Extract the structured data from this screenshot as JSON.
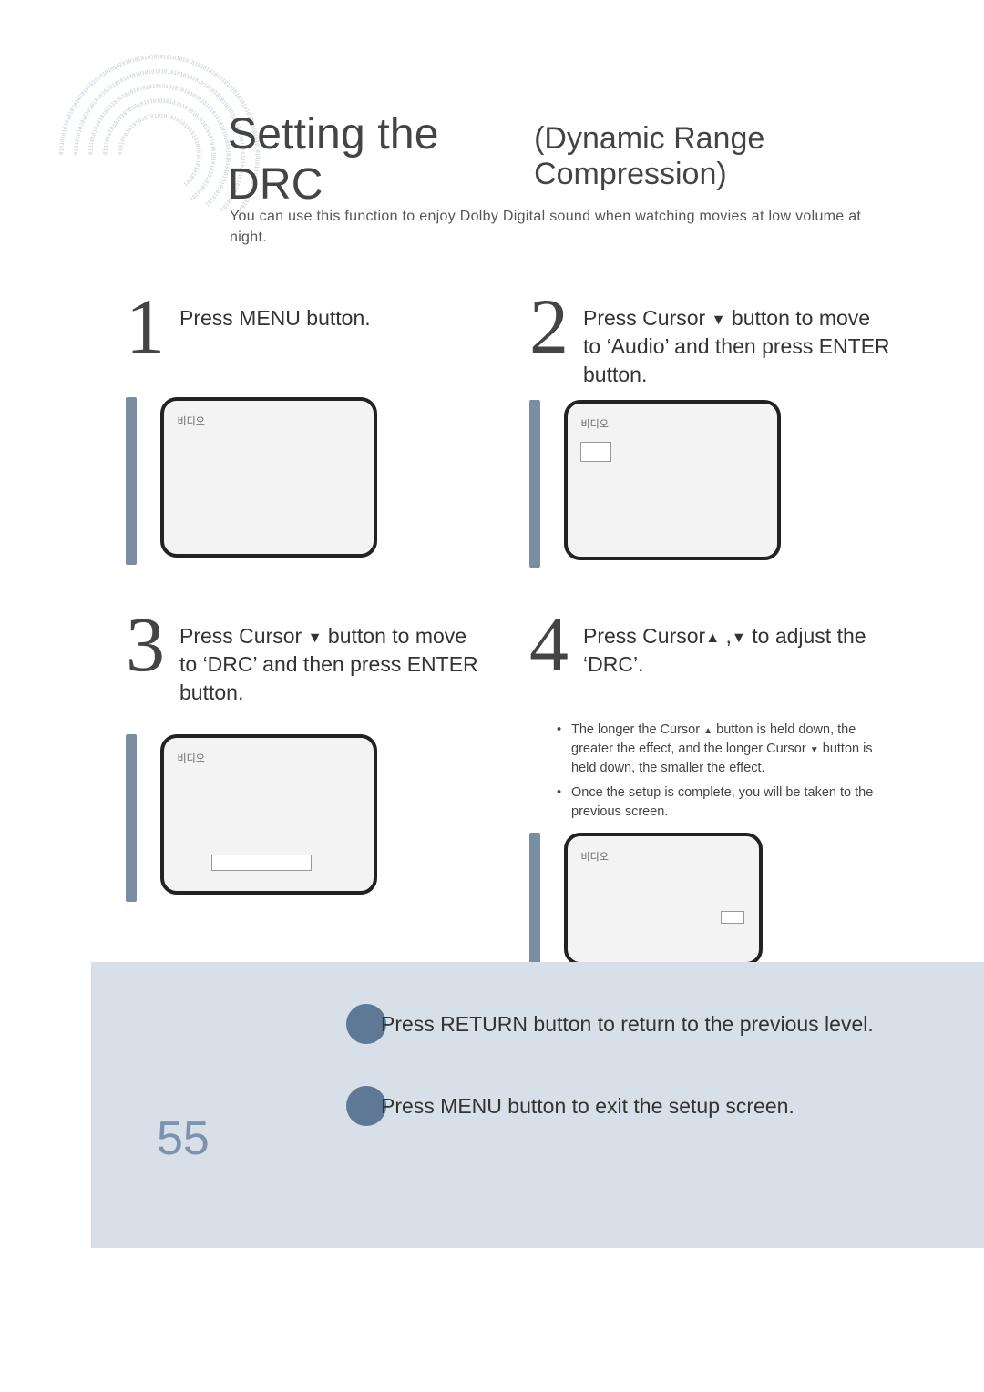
{
  "title": {
    "main": "Setting the DRC",
    "sub": "(Dynamic Range Compression)"
  },
  "intro": "You can use this function to enjoy Dolby Digital sound when watching movies at low volume at night.",
  "steps": {
    "s1": {
      "num": "1",
      "text": "Press MENU button."
    },
    "s2": {
      "num": "2",
      "text_pre": "Press Cursor ",
      "text_post": " button to move to ‘Audio’ and then press ENTER button."
    },
    "s3": {
      "num": "3",
      "text_pre": "Press Cursor ",
      "text_post": " button to move to ‘DRC’ and then press ENTER button."
    },
    "s4": {
      "num": "4",
      "text_pre": "Press Cursor",
      "text_mid": " ,",
      "text_post": "   to adjust the ‘DRC’."
    }
  },
  "notes": {
    "n1_pre": "The longer the Cursor ",
    "n1_mid": " button is held down, the greater the effect, and the longer Cursor ",
    "n1_post": " button is held down, the smaller the effect.",
    "n2": "Once the setup is complete, you will be taken to the previous screen."
  },
  "tv_label": "비디오",
  "tips": {
    "t1": "Press RETURN button to return to the previous level.",
    "t2": "Press MENU button to exit the setup screen."
  },
  "page_number": "55"
}
